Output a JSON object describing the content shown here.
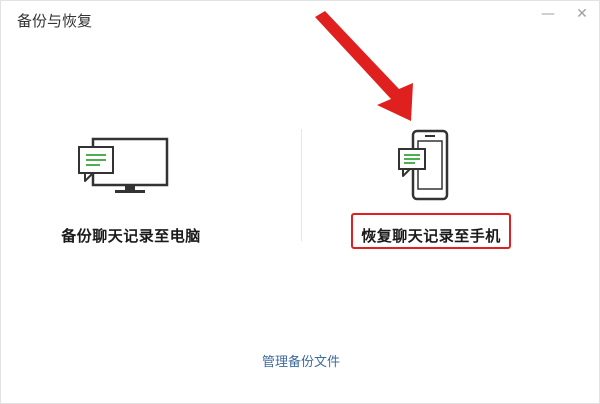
{
  "window": {
    "title": "备份与恢复",
    "minimize_glyph": "—",
    "close_glyph": "✕"
  },
  "options": {
    "backup_to_pc": {
      "label": "备份聊天记录至电脑",
      "icon": "monitor-chat-icon"
    },
    "restore_to_phone": {
      "label": "恢复聊天记录至手机",
      "icon": "phone-chat-icon"
    }
  },
  "footer": {
    "manage_link": "管理备份文件"
  },
  "colors": {
    "chat_bubble": "#4caf50",
    "highlight": "#e02020",
    "arrow": "#e0201e",
    "link": "#3d6c9e"
  }
}
